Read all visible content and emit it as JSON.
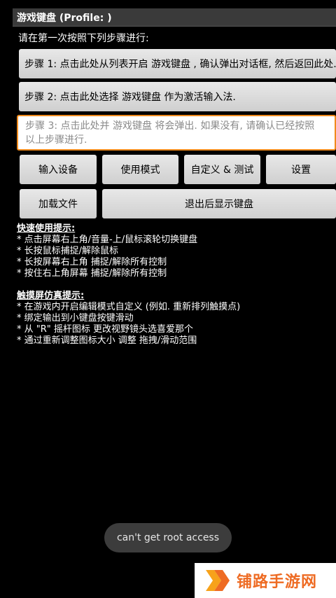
{
  "title_bar": {
    "title": "游戏键盘 (Profile: )"
  },
  "intro": {
    "text": "请在第一次按照下列步骤进行:"
  },
  "steps": {
    "step1": "步骤 1: 点击此处从列表开启 游戏键盘 , 确认弹出对话框, 然后返回此处.",
    "step2": "步骤 2: 点击此处选择 游戏键盘 作为激活输入法.",
    "step3_line1": "步骤 3: 点击此处并 游戏键盘 将会弹出. 如果没有, 请确认已经按照",
    "step3_line2": "以上步骤进行."
  },
  "buttons": {
    "input_device": "输入设备",
    "usage_mode": "使用模式",
    "custom_test": "自定义 & 测试",
    "settings": "设置",
    "load_file": "加载文件",
    "show_keyboard_on_exit": "退出后显示键盘"
  },
  "quick_tips": {
    "heading": "快速使用提示:",
    "lines": [
      "* 点击屏幕右上角/音量-上/鼠标滚轮切换键盘",
      "* 长按鼠标捕捉/解除鼠标",
      "* 长按屏幕右上角 捕捉/解除所有控制",
      "* 按住右上角屏幕 捕捉/解除所有控制"
    ]
  },
  "touch_tips": {
    "heading": "触摸屏仿真提示:",
    "lines": [
      "* 在游戏内开启编辑模式自定义 (例如. 重新排列触摸点)",
      "* 绑定输出到小键盘按键滑动",
      "* 从 \"R\" 摇杆图标 更改视野镜头选喜爱那个",
      "* 通过重新调整图标大小 调整 拖拽/滑动范围"
    ]
  },
  "toast": {
    "text": "can't get root access"
  },
  "watermark": {
    "text": "铺路手游网",
    "icon": "chevron-logo-icon"
  },
  "colors": {
    "background": "#000000",
    "title_bar": "#3a3a3a",
    "button": "#d9d9d9",
    "input_focus_border": "#f08a1c",
    "toast": "#3c3c3c",
    "watermark_text": "#ee6b23"
  }
}
